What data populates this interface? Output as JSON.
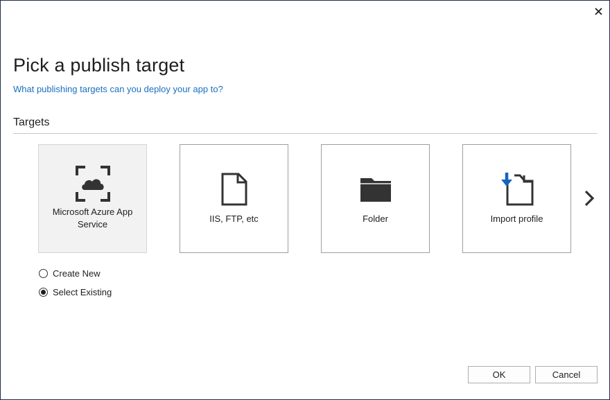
{
  "dialog": {
    "close_icon": "close-icon",
    "title": "Pick a publish target",
    "subtitle_link": "What publishing targets can you deploy your app to?"
  },
  "targets": {
    "section_label": "Targets",
    "tiles": [
      {
        "label": "Microsoft Azure App Service",
        "icon": "azure-app-service-icon",
        "selected": true
      },
      {
        "label": "IIS, FTP, etc",
        "icon": "file-icon",
        "selected": false
      },
      {
        "label": "Folder",
        "icon": "folder-icon",
        "selected": false
      },
      {
        "label": "Import profile",
        "icon": "import-profile-icon",
        "selected": false
      }
    ],
    "next_icon": "chevron-right-icon"
  },
  "options": [
    {
      "label": "Create New",
      "checked": false
    },
    {
      "label": "Select Existing",
      "checked": true
    }
  ],
  "footer": {
    "ok_label": "OK",
    "cancel_label": "Cancel"
  },
  "colors": {
    "link": "#1a6fc0",
    "import_arrow": "#1565c0",
    "icon_dark": "#333333",
    "selected_tile_bg": "#f2f2f2"
  }
}
